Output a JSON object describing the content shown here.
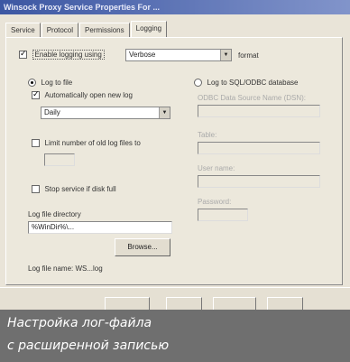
{
  "window": {
    "title": "Winsock Proxy Service Properties For ..."
  },
  "tabs": [
    {
      "label": "Service"
    },
    {
      "label": "Protocol"
    },
    {
      "label": "Permissions"
    },
    {
      "label": "Logging"
    }
  ],
  "logging": {
    "enable_label": "Enable logging using",
    "format_value": "Verbose",
    "format_suffix": "format",
    "log_to_file_label": "Log to file",
    "auto_new_log_label": "Automatically open new log",
    "period_value": "Daily",
    "limit_logs_label": "Limit number of old log files to",
    "stop_service_label": "Stop service if disk full",
    "directory_label": "Log file directory",
    "directory_value": "%WinDir%\\...",
    "browse_label": "Browse...",
    "filename_label": "Log file name: WS...log",
    "log_to_db_label": "Log to SQL/ODBC database",
    "db_fields": [
      {
        "label": "ODBC Data Source Name (DSN):"
      },
      {
        "label": "Table:"
      },
      {
        "label": "User name:"
      },
      {
        "label": "Password:"
      }
    ]
  },
  "caption": {
    "line1": "Настройка лог-файла",
    "line2": "с расширенной записью"
  }
}
